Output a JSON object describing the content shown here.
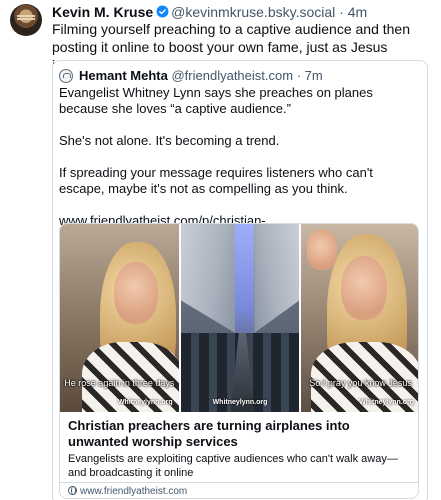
{
  "post": {
    "author_name": "Kevin M. Kruse",
    "handle": "@kevinmkruse.bsky.social",
    "separator": "·",
    "time": "4m",
    "text": "Filming yourself preaching to a captive audience and then posting it online to boost your own fame, just as Jesus instructed."
  },
  "quote": {
    "author_name": "Hemant Mehta",
    "handle": "@friendlyatheist.com",
    "separator": "·",
    "time": "7m",
    "paragraphs": [
      "Evangelist Whitney Lynn says she preaches on planes because she loves “a captive audience.”",
      "She's not alone. It's becoming a trend.",
      "If spreading your message requires listeners who can't escape, maybe it's not as compelling as you think.",
      "www.friendlyatheist.com/p/christian-..."
    ]
  },
  "link_card": {
    "thumbnails": [
      {
        "caption": "He rose again in three days",
        "watermark": "Whitneylynn.org"
      },
      {
        "caption": "",
        "watermark": "Whitneylynn.org"
      },
      {
        "caption": "So I pray you know Jesus",
        "watermark": "Whitneylynn.org"
      }
    ],
    "title": "Christian preachers are turning airplanes into unwanted worship services",
    "description": "Evangelists are exploiting captive audiences who can't walk away—and broadcasting it online",
    "domain": "www.friendlyatheist.com"
  },
  "colors": {
    "verified_badge": "#1185fe",
    "secondary_text": "#42576c",
    "border": "#d4dbe2"
  },
  "icons": {
    "verified": "verified-check-icon",
    "link": "globe-icon"
  }
}
